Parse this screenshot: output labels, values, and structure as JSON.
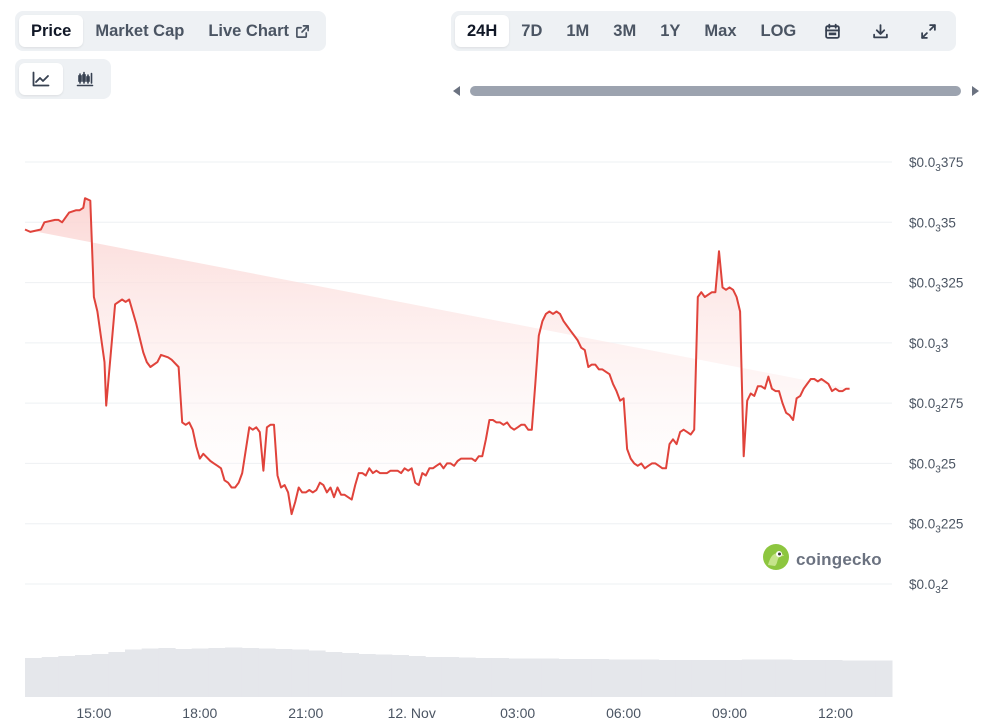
{
  "metric_tabs": [
    {
      "label": "Price",
      "active": true
    },
    {
      "label": "Market Cap",
      "active": false
    },
    {
      "label": "Live Chart",
      "active": false
    }
  ],
  "chart_type_buttons": [
    {
      "icon": "line-chart-icon",
      "active": true
    },
    {
      "icon": "candlestick-chart-icon",
      "active": false
    }
  ],
  "range_tabs": [
    {
      "label": "24H",
      "active": true
    },
    {
      "label": "7D",
      "active": false
    },
    {
      "label": "1M",
      "active": false
    },
    {
      "label": "3M",
      "active": false
    },
    {
      "label": "1Y",
      "active": false
    },
    {
      "label": "Max",
      "active": false
    },
    {
      "label": "LOG",
      "active": false
    }
  ],
  "toolbar_icons": [
    "calendar-icon",
    "download-icon",
    "expand-icon"
  ],
  "watermark": {
    "text": "coingecko"
  },
  "colors": {
    "line": "#e0433b",
    "fill_top": "#fbd5d3",
    "volume": "#e5e7eb",
    "grid": "#eef0f3"
  },
  "chart_data": {
    "type": "area",
    "x_ticks": [
      "15:00",
      "18:00",
      "21:00",
      "12. Nov",
      "03:00",
      "06:00",
      "09:00",
      "12:00"
    ],
    "y_ticks": [
      {
        "prefix": "$0.0",
        "sub": "3",
        "rest": "375",
        "value": 0.000375
      },
      {
        "prefix": "$0.0",
        "sub": "3",
        "rest": "35",
        "value": 0.00035
      },
      {
        "prefix": "$0.0",
        "sub": "3",
        "rest": "325",
        "value": 0.000325
      },
      {
        "prefix": "$0.0",
        "sub": "3",
        "rest": "3",
        "value": 0.0003
      },
      {
        "prefix": "$0.0",
        "sub": "3",
        "rest": "275",
        "value": 0.000275
      },
      {
        "prefix": "$0.0",
        "sub": "3",
        "rest": "25",
        "value": 0.00025
      },
      {
        "prefix": "$0.0",
        "sub": "3",
        "rest": "225",
        "value": 0.000225
      },
      {
        "prefix": "$0.0",
        "sub": "3",
        "rest": "2",
        "value": 0.0002
      }
    ],
    "x_range_hours": [
      13.05,
      37.6
    ],
    "tick_hours": [
      15,
      18,
      21,
      24,
      27,
      30,
      33,
      36
    ],
    "ylim": [
      0.0002,
      0.000375
    ],
    "grid": true,
    "series": [
      {
        "hours": [
          13.05,
          13.2,
          13.5,
          13.6,
          13.9,
          14.0,
          14.1,
          14.3,
          14.5,
          14.6,
          14.7,
          14.75,
          14.9,
          15.0,
          15.1,
          15.3,
          15.35,
          15.6,
          15.8,
          15.9,
          16.0,
          16.2,
          16.4,
          16.5,
          16.6,
          16.8,
          16.9,
          17.1,
          17.2,
          17.4,
          17.5,
          17.6,
          17.7,
          17.8,
          17.9,
          18.0,
          18.1,
          18.3,
          18.4,
          18.5,
          18.6,
          18.7,
          18.8,
          18.9,
          19.0,
          19.1,
          19.2,
          19.4,
          19.5,
          19.6,
          19.7,
          19.8,
          19.9,
          20.0,
          20.1,
          20.2,
          20.3,
          20.4,
          20.5,
          20.6,
          20.7,
          20.8,
          20.9,
          21.0,
          21.1,
          21.2,
          21.3,
          21.4,
          21.5,
          21.6,
          21.7,
          21.8,
          21.9,
          22.0,
          22.1,
          22.2,
          22.3,
          22.4,
          22.5,
          22.6,
          22.7,
          22.8,
          22.9,
          23.0,
          23.1,
          23.2,
          23.3,
          23.4,
          23.5,
          23.6,
          23.7,
          23.8,
          23.9,
          24.0,
          24.1,
          24.2,
          24.3,
          24.4,
          24.5,
          24.6,
          24.7,
          24.8,
          24.9,
          25.0,
          25.1,
          25.2,
          25.3,
          25.4,
          25.5,
          25.6,
          25.7,
          25.8,
          25.9,
          26.0,
          26.1,
          26.2,
          26.3,
          26.4,
          26.5,
          26.6,
          26.7,
          26.8,
          26.9,
          27.0,
          27.1,
          27.2,
          27.3,
          27.4,
          27.5,
          27.6,
          27.7,
          27.8,
          27.9,
          28.0,
          28.1,
          28.2,
          28.3,
          28.4,
          28.5,
          28.6,
          28.7,
          28.8,
          28.9,
          29.0,
          29.1,
          29.2,
          29.3,
          29.4,
          29.5,
          29.6,
          29.7,
          29.8,
          29.9,
          30.0,
          30.1,
          30.2,
          30.3,
          30.4,
          30.5,
          30.6,
          30.7,
          30.8,
          30.9,
          31.0,
          31.1,
          31.2,
          31.3,
          31.4,
          31.5,
          31.6,
          31.7,
          31.8,
          31.9,
          32.0,
          32.1,
          32.2,
          32.3,
          32.4,
          32.5,
          32.6,
          32.7,
          32.8,
          32.9,
          33.0,
          33.1,
          33.2,
          33.3,
          33.4,
          33.5,
          33.6,
          33.7,
          33.8,
          33.9,
          34.0,
          34.1,
          34.2,
          34.3,
          34.4,
          34.5,
          34.6,
          34.7,
          34.8,
          34.9,
          35.0,
          35.1,
          35.2,
          35.3,
          35.4,
          35.5,
          35.6,
          35.7,
          35.8,
          35.9,
          36.0,
          36.1,
          36.2,
          36.3,
          36.4,
          36.5,
          36.6,
          36.7,
          36.8,
          36.9,
          37.0,
          37.1,
          37.2,
          37.3,
          37.4,
          37.6
        ],
        "values": [
          0.000347,
          0.000346,
          0.000347,
          0.00035,
          0.000351,
          0.000351,
          0.00035,
          0.000354,
          0.000355,
          0.000355,
          0.000356,
          0.00036,
          0.000359,
          0.000319,
          0.000313,
          0.000292,
          0.000274,
          0.000316,
          0.000318,
          0.000317,
          0.000318,
          0.000308,
          0.000296,
          0.000292,
          0.00029,
          0.000292,
          0.000295,
          0.000294,
          0.000293,
          0.00029,
          0.000267,
          0.000266,
          0.000267,
          0.000264,
          0.000257,
          0.000252,
          0.000254,
          0.000251,
          0.00025,
          0.000249,
          0.000248,
          0.000243,
          0.000242,
          0.00024,
          0.00024,
          0.000242,
          0.000246,
          0.000265,
          0.000264,
          0.000265,
          0.000263,
          0.000247,
          0.000265,
          0.000266,
          0.000266,
          0.000245,
          0.00024,
          0.000241,
          0.000238,
          0.000229,
          0.000234,
          0.00024,
          0.000238,
          0.000238,
          0.000239,
          0.000238,
          0.000239,
          0.000242,
          0.000241,
          0.000238,
          0.00024,
          0.000236,
          0.00024,
          0.000237,
          0.000237,
          0.000236,
          0.000235,
          0.000241,
          0.000246,
          0.000246,
          0.000245,
          0.000248,
          0.000246,
          0.000247,
          0.000246,
          0.000246,
          0.000246,
          0.000247,
          0.000247,
          0.000247,
          0.000246,
          0.000248,
          0.000247,
          0.000248,
          0.000242,
          0.000241,
          0.000246,
          0.000245,
          0.000248,
          0.000248,
          0.000249,
          0.00025,
          0.000248,
          0.00025,
          0.00025,
          0.000249,
          0.000251,
          0.000252,
          0.000252,
          0.000252,
          0.000252,
          0.000251,
          0.000253,
          0.000253,
          0.00026,
          0.000268,
          0.000268,
          0.000267,
          0.000267,
          0.000266,
          0.000267,
          0.000265,
          0.000264,
          0.000265,
          0.000266,
          0.000266,
          0.000264,
          0.000264,
          0.000283,
          0.000303,
          0.000309,
          0.000312,
          0.000313,
          0.000312,
          0.000313,
          0.000312,
          0.000309,
          0.000307,
          0.000305,
          0.000303,
          0.000301,
          0.000298,
          0.000297,
          0.00029,
          0.000291,
          0.000291,
          0.000289,
          0.000289,
          0.000288,
          0.000287,
          0.000283,
          0.00028,
          0.000276,
          0.000277,
          0.000256,
          0.000252,
          0.00025,
          0.000249,
          0.00025,
          0.000248,
          0.000249,
          0.00025,
          0.00025,
          0.000249,
          0.000248,
          0.000248,
          0.000258,
          0.00026,
          0.000258,
          0.000263,
          0.000264,
          0.000263,
          0.000262,
          0.000264,
          0.000319,
          0.000321,
          0.000319,
          0.00032,
          0.000321,
          0.000321,
          0.000338,
          0.000323,
          0.000322,
          0.000323,
          0.000322,
          0.000319,
          0.000313,
          0.000253,
          0.000276,
          0.000279,
          0.000278,
          0.000282,
          0.000282,
          0.000281,
          0.000286,
          0.000281,
          0.00028,
          0.00028,
          0.000275,
          0.000271,
          0.00027,
          0.000268,
          0.000277,
          0.000278,
          0.000281,
          0.000283,
          0.000285,
          0.000285,
          0.000284,
          0.000285,
          0.000284,
          0.000283,
          0.00028,
          0.000281,
          0.00028,
          0.00028,
          0.000281,
          0.000281
        ]
      }
    ],
    "volume_relative": [
      0.78,
      0.8,
      0.82,
      0.84,
      0.86,
      0.9,
      0.95,
      0.97,
      0.98,
      0.96,
      0.97,
      0.98,
      0.99,
      0.98,
      0.97,
      0.96,
      0.95,
      0.93,
      0.9,
      0.88,
      0.86,
      0.85,
      0.84,
      0.82,
      0.8,
      0.8,
      0.79,
      0.78,
      0.78,
      0.77,
      0.77,
      0.77,
      0.76,
      0.76,
      0.76,
      0.75,
      0.75,
      0.75,
      0.74,
      0.74,
      0.74,
      0.74,
      0.74,
      0.75,
      0.75,
      0.75,
      0.74,
      0.74,
      0.74,
      0.73,
      0.73,
      0.73
    ]
  }
}
